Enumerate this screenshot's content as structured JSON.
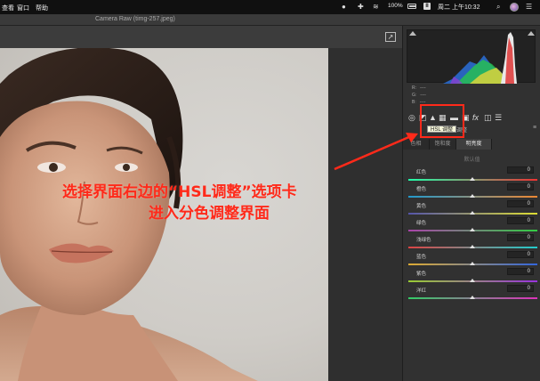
{
  "menubar": {
    "items": [
      "查看",
      "窗口",
      "帮助"
    ],
    "battery_percent": "100%",
    "hidpi_badge": "II",
    "clock": "周二 上午10:32",
    "icons": [
      "wechat-icon",
      "plus-cross-icon",
      "wifi-icon",
      "battery-icon",
      "display-icon",
      "search-icon",
      "user-avatar-icon",
      "list-icon"
    ]
  },
  "window": {
    "title": "Camera Raw (timg-257.jpeg)",
    "export_icon": "export-icon"
  },
  "histogram": {
    "r_label": "R:",
    "r_value": "----",
    "g_label": "G:",
    "g_value": "----",
    "b_label": "B:",
    "b_value": "----"
  },
  "tools": {
    "icons": [
      "aperture-icon",
      "mountain-icon",
      "hsl-grid-icon",
      "split-tone-icon",
      "lens-icon",
      "fx-icon",
      "camera-calibration-icon",
      "presets-icon"
    ],
    "fx_label": "fx",
    "tooltip": "HSL 调整",
    "panel_title": "调整",
    "panel_menu": "≡"
  },
  "hsl": {
    "tabs": [
      "色相",
      "饱和度",
      "明亮度"
    ],
    "active_tab": 2,
    "section": "默认值",
    "rows": [
      {
        "label": "红色",
        "value": "0"
      },
      {
        "label": "橙色",
        "value": "0"
      },
      {
        "label": "黄色",
        "value": "0"
      },
      {
        "label": "绿色",
        "value": "0"
      },
      {
        "label": "浅绿色",
        "value": "0"
      },
      {
        "label": "蓝色",
        "value": "0"
      },
      {
        "label": "紫色",
        "value": "0"
      },
      {
        "label": "洋红",
        "value": "0"
      }
    ]
  },
  "annotation": {
    "line1": "选择界面右边的“HSL调整”选项卡",
    "line2": "进入分色调整界面",
    "color": "#ff2a1a"
  },
  "colors": {
    "panel_bg": "#313131",
    "accent_red": "#ff2a1a"
  }
}
